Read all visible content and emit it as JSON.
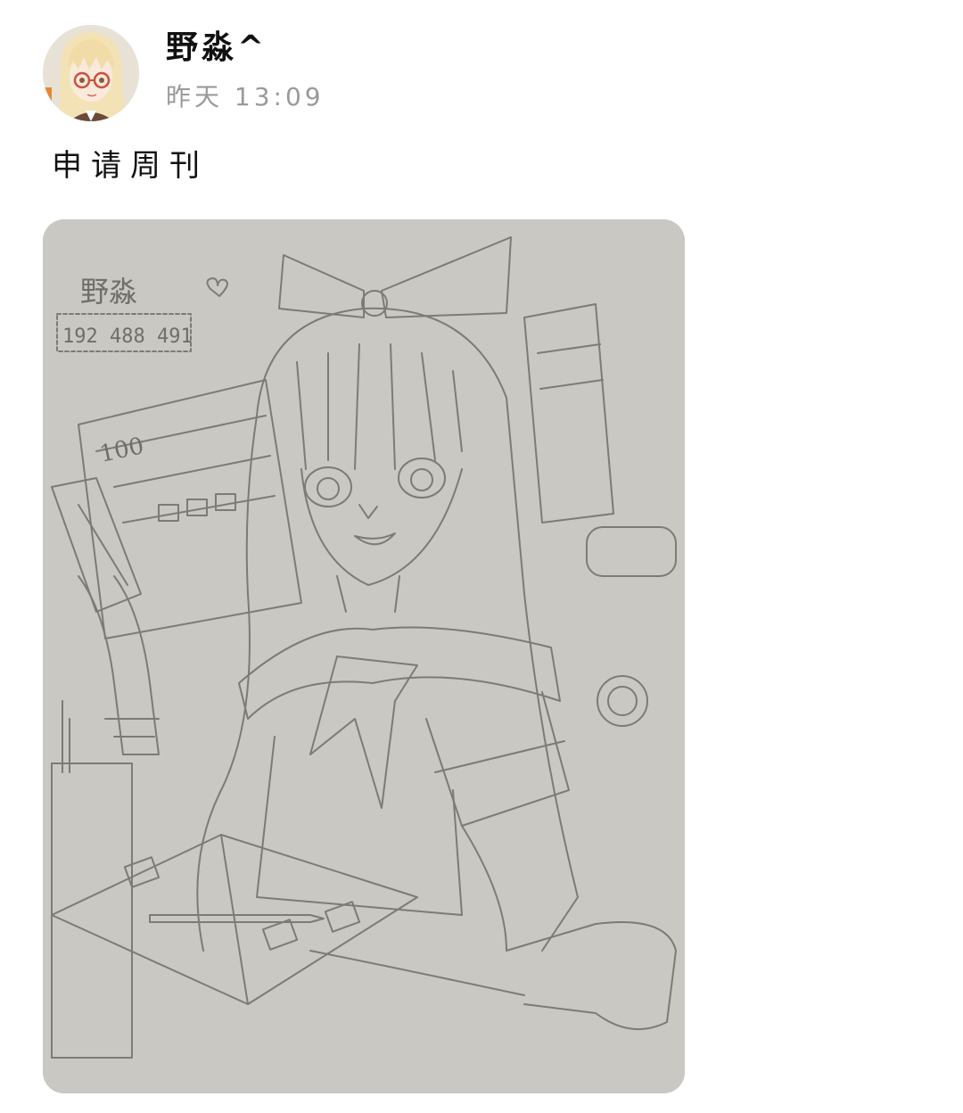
{
  "post": {
    "username": "野淼^",
    "timestamp": "昨天 13:09",
    "text": "申请周刊"
  },
  "image": {
    "signature": "野淼",
    "qq_number": "192 488 491",
    "book_marking": "100"
  },
  "colors": {
    "timestamp": "#9a9a9a",
    "paper": "#c9c8c2",
    "pencil": "#7c7b76"
  },
  "icons": {
    "avatar": "anime-girl-with-glasses-avatar"
  }
}
